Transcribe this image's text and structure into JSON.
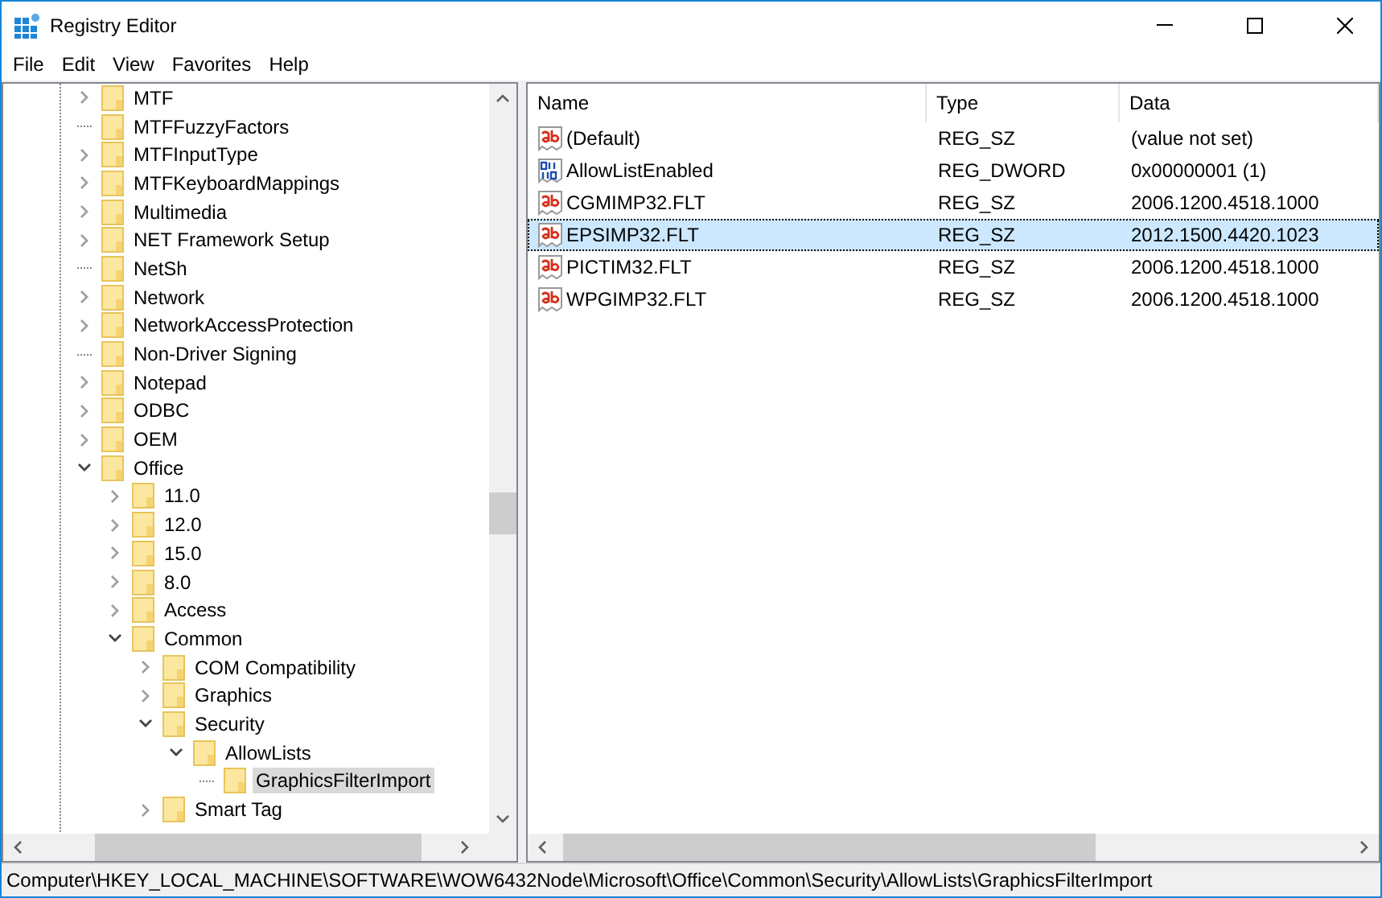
{
  "window": {
    "title": "Registry Editor"
  },
  "menu": [
    {
      "label": "File"
    },
    {
      "label": "Edit"
    },
    {
      "label": "View"
    },
    {
      "label": "Favorites"
    },
    {
      "label": "Help"
    }
  ],
  "tree": [
    {
      "label": "MTF",
      "has_children": true,
      "expanded": false,
      "selected": false
    },
    {
      "label": "MTFFuzzyFactors",
      "has_children": false,
      "selected": false
    },
    {
      "label": "MTFInputType",
      "has_children": true,
      "expanded": false,
      "selected": false
    },
    {
      "label": "MTFKeyboardMappings",
      "has_children": true,
      "expanded": false,
      "selected": false
    },
    {
      "label": "Multimedia",
      "has_children": true,
      "expanded": false,
      "selected": false
    },
    {
      "label": "NET Framework Setup",
      "has_children": true,
      "expanded": false,
      "selected": false
    },
    {
      "label": "NetSh",
      "has_children": false,
      "selected": false
    },
    {
      "label": "Network",
      "has_children": true,
      "expanded": false,
      "selected": false
    },
    {
      "label": "NetworkAccessProtection",
      "has_children": true,
      "expanded": false,
      "selected": false
    },
    {
      "label": "Non-Driver Signing",
      "has_children": false,
      "selected": false
    },
    {
      "label": "Notepad",
      "has_children": true,
      "expanded": false,
      "selected": false
    },
    {
      "label": "ODBC",
      "has_children": true,
      "expanded": false,
      "selected": false
    },
    {
      "label": "OEM",
      "has_children": true,
      "expanded": false,
      "selected": false
    },
    {
      "label": "Office",
      "has_children": true,
      "expanded": true,
      "selected": false,
      "children": [
        {
          "label": "11.0",
          "has_children": true,
          "expanded": false,
          "selected": false
        },
        {
          "label": "12.0",
          "has_children": true,
          "expanded": false,
          "selected": false
        },
        {
          "label": "15.0",
          "has_children": true,
          "expanded": false,
          "selected": false
        },
        {
          "label": "8.0",
          "has_children": true,
          "expanded": false,
          "selected": false
        },
        {
          "label": "Access",
          "has_children": true,
          "expanded": false,
          "selected": false
        },
        {
          "label": "Common",
          "has_children": true,
          "expanded": true,
          "selected": false,
          "children": [
            {
              "label": "COM Compatibility",
              "has_children": true,
              "expanded": false,
              "selected": false
            },
            {
              "label": "Graphics",
              "has_children": true,
              "expanded": false,
              "selected": false
            },
            {
              "label": "Security",
              "has_children": true,
              "expanded": true,
              "selected": false,
              "children": [
                {
                  "label": "AllowLists",
                  "has_children": true,
                  "expanded": true,
                  "selected": false,
                  "children": [
                    {
                      "label": "GraphicsFilterImport",
                      "has_children": false,
                      "selected": true
                    }
                  ]
                }
              ]
            },
            {
              "label": "Smart Tag",
              "has_children": true,
              "expanded": false,
              "selected": false
            }
          ]
        }
      ]
    }
  ],
  "table": {
    "columns": [
      "Name",
      "Type",
      "Data"
    ],
    "rows": [
      {
        "name": "(Default)",
        "type": "REG_SZ",
        "data": "(value not set)",
        "kind": "string",
        "selected": false
      },
      {
        "name": "AllowListEnabled",
        "type": "REG_DWORD",
        "data": "0x00000001 (1)",
        "kind": "binary",
        "selected": false
      },
      {
        "name": "CGMIMP32.FLT",
        "type": "REG_SZ",
        "data": "2006.1200.4518.1000",
        "kind": "string",
        "selected": false
      },
      {
        "name": "EPSIMP32.FLT",
        "type": "REG_SZ",
        "data": "2012.1500.4420.1023",
        "kind": "string",
        "selected": true
      },
      {
        "name": "PICTIM32.FLT",
        "type": "REG_SZ",
        "data": "2006.1200.4518.1000",
        "kind": "string",
        "selected": false
      },
      {
        "name": "WPGIMP32.FLT",
        "type": "REG_SZ",
        "data": "2006.1200.4518.1000",
        "kind": "string",
        "selected": false
      }
    ]
  },
  "status_bar": "Computer\\HKEY_LOCAL_MACHINE\\SOFTWARE\\WOW6432Node\\Microsoft\\Office\\Common\\Security\\AllowLists\\GraphicsFilterImport"
}
